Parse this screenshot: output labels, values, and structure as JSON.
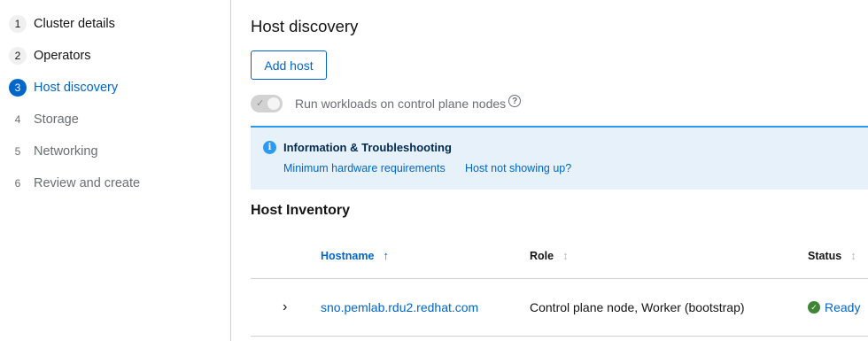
{
  "wizard": {
    "steps": [
      {
        "num": "1",
        "label": "Cluster details"
      },
      {
        "num": "2",
        "label": "Operators"
      },
      {
        "num": "3",
        "label": "Host discovery"
      },
      {
        "num": "4",
        "label": "Storage"
      },
      {
        "num": "5",
        "label": "Networking"
      },
      {
        "num": "6",
        "label": "Review and create"
      }
    ]
  },
  "main": {
    "title": "Host discovery",
    "add_host_label": "Add host",
    "toggle_label": "Run workloads on control plane nodes",
    "alert": {
      "title": "Information & Troubleshooting",
      "link1": "Minimum hardware requirements",
      "link2": "Host not showing up?"
    },
    "inventory_title": "Host Inventory",
    "table": {
      "headers": {
        "hostname": "Hostname",
        "role": "Role",
        "status": "Status"
      },
      "rows": [
        {
          "hostname": "sno.pemlab.rdu2.redhat.com",
          "role": "Control plane node, Worker (bootstrap)",
          "status": "Ready"
        }
      ]
    }
  },
  "colors": {
    "accent": "#0066cc",
    "info": "#2b9af3",
    "success": "#3e8635"
  }
}
